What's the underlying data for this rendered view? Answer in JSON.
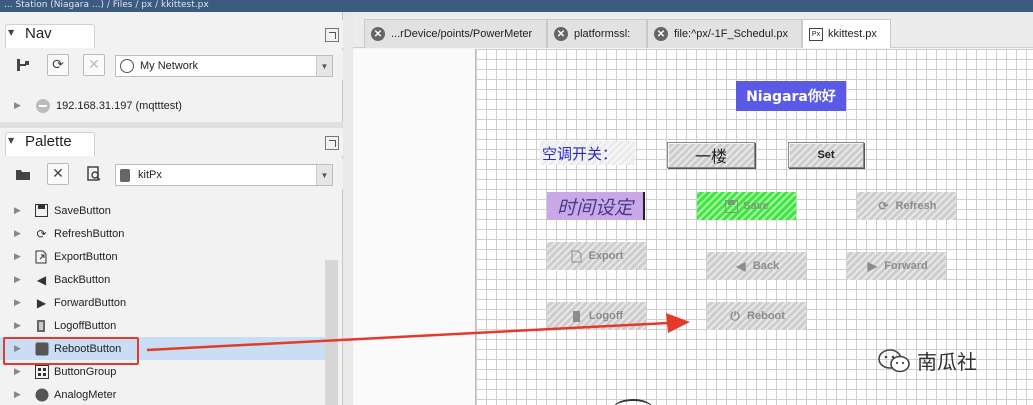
{
  "window": {
    "title_fragment": "... Station (Niagara ...)  /  Files  /  px  /  kkittest.px"
  },
  "nav": {
    "title": "Nav",
    "network_select": "My Network",
    "tree_item": "192.168.31.197 (mqtttest)"
  },
  "palette": {
    "title": "Palette",
    "module_select": "kitPx",
    "items": [
      {
        "label": "SaveButton",
        "icon": "save-icon"
      },
      {
        "label": "RefreshButton",
        "icon": "refresh-icon"
      },
      {
        "label": "ExportButton",
        "icon": "export-icon"
      },
      {
        "label": "BackButton",
        "icon": "back-icon"
      },
      {
        "label": "ForwardButton",
        "icon": "forward-icon"
      },
      {
        "label": "LogoffButton",
        "icon": "logoff-icon"
      },
      {
        "label": "RebootButton",
        "icon": "reboot-icon",
        "selected": true
      },
      {
        "label": "ButtonGroup",
        "icon": "button-group-icon"
      },
      {
        "label": "AnalogMeter",
        "icon": "meter-icon"
      }
    ]
  },
  "tabs": [
    {
      "label": "...rDevice/points/PowerMeter",
      "icon": "close-icon"
    },
    {
      "label": "platformssl:",
      "icon": "close-icon"
    },
    {
      "label": "file:^px/-1F_Schedul.px",
      "icon": "close-icon"
    },
    {
      "label": "kkittest.px",
      "icon": "px-file-icon",
      "active": true
    }
  ],
  "canvas": {
    "niagara_label": "Niagara你好",
    "ac_switch_label": "空调开关：",
    "floor_button": "一楼",
    "set_button": "Set",
    "time_setting_label": "时间设定",
    "save_button": "Save",
    "refresh_button": "Refresh",
    "export_button": "Export",
    "back_button": "Back",
    "forward_button": "Forward",
    "logoff_button": "Logoff",
    "reboot_button": "Reboot"
  },
  "colors": {
    "highlight_red": "#e53a2a",
    "niagara_label_bg": "#5a5ae6",
    "save_green": "#3ee63e",
    "time_label_bg": "#c8a8e6",
    "selection_blue": "#c9def5"
  },
  "watermark": {
    "text": "南瓜社"
  }
}
